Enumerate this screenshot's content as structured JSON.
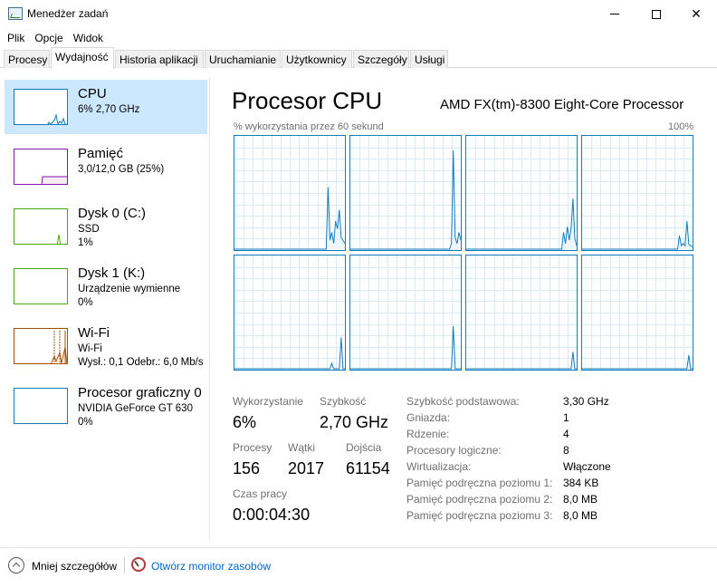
{
  "window": {
    "title": "Menedżer zadań"
  },
  "menu": [
    "Plik",
    "Opcje",
    "Widok"
  ],
  "tabs": [
    {
      "label": "Procesy",
      "active": false
    },
    {
      "label": "Wydajność",
      "active": true
    },
    {
      "label": "Historia aplikacji",
      "active": false
    },
    {
      "label": "Uruchamianie",
      "active": false
    },
    {
      "label": "Użytkownicy",
      "active": false
    },
    {
      "label": "Szczegóły",
      "active": false
    },
    {
      "label": "Usługi",
      "active": false
    }
  ],
  "resources": [
    {
      "title": "CPU",
      "line1": "6% 2,70 GHz",
      "line2": "",
      "color": "#117dbb",
      "selected": true
    },
    {
      "title": "Pamięć",
      "line1": "3,0/12,0 GB (25%)",
      "line2": "",
      "color": "#8b12ae",
      "selected": false
    },
    {
      "title": "Dysk 0 (C:)",
      "line1": "SSD",
      "line2": "1%",
      "color": "#4da60c",
      "selected": false
    },
    {
      "title": "Dysk 1 (K:)",
      "line1": "Urządzenie wymienne",
      "line2": "0%",
      "color": "#4da60c",
      "selected": false
    },
    {
      "title": "Wi-Fi",
      "line1": "Wi-Fi",
      "line2": "Wysł.: 0,1 Odebr.: 6,0 Mb/s",
      "color": "#a74f01",
      "selected": false
    },
    {
      "title": "Procesor graficzny 0",
      "line1": "NVIDIA GeForce GT 630",
      "line2": "0%",
      "color": "#117dbb",
      "selected": false
    }
  ],
  "main": {
    "title": "Procesor CPU",
    "processor_name": "AMD FX(tm)-8300 Eight-Core Processor",
    "graph_caption": "% wykorzystania przez 60 sekund",
    "graph_max": "100%",
    "graph_color": "#117dbb"
  },
  "stats": {
    "utilization_label": "Wykorzystanie",
    "utilization_value": "6%",
    "speed_label": "Szybkość",
    "speed_value": "2,70 GHz",
    "processes_label": "Procesy",
    "processes_value": "156",
    "threads_label": "Wątki",
    "threads_value": "2017",
    "handles_label": "Dojścia",
    "handles_value": "61154",
    "uptime_label": "Czas pracy",
    "uptime_value": "0:00:04:30"
  },
  "specs": [
    {
      "label": "Szybkość podstawowa:",
      "value": "3,30 GHz"
    },
    {
      "label": "Gniazda:",
      "value": "1"
    },
    {
      "label": "Rdzenie:",
      "value": "4"
    },
    {
      "label": "Procesory logiczne:",
      "value": "8"
    },
    {
      "label": "Wirtualizacja:",
      "value": "Włączone"
    },
    {
      "label": "Pamięć podręczna poziomu 1:",
      "value": "384 KB"
    },
    {
      "label": "Pamięć podręczna poziomu 2:",
      "value": "8,0 MB"
    },
    {
      "label": "Pamięć podręczna poziomu 3:",
      "value": "8,0 MB"
    }
  ],
  "footer": {
    "less_details": "Mniej szczegółów",
    "open_monitor": "Otwórz monitor zasobów"
  },
  "chart_data": {
    "type": "line",
    "ylim": [
      0,
      100
    ],
    "series": [
      {
        "values": [
          0,
          0,
          0,
          0,
          0,
          0,
          0,
          0,
          0,
          0,
          0,
          0,
          0,
          0,
          0,
          0,
          0,
          0,
          0,
          0,
          0,
          0,
          0,
          0,
          0,
          0,
          0,
          0,
          0,
          0,
          0,
          0,
          0,
          0,
          0,
          0,
          0,
          0,
          0,
          0,
          0,
          0,
          0,
          0,
          0,
          0,
          0,
          0,
          0,
          0,
          55,
          8,
          15,
          5,
          25,
          18,
          35,
          10,
          8,
          5
        ]
      },
      {
        "values": [
          0,
          0,
          0,
          0,
          0,
          0,
          0,
          0,
          0,
          0,
          0,
          0,
          0,
          0,
          0,
          0,
          0,
          0,
          0,
          0,
          0,
          0,
          0,
          0,
          0,
          0,
          0,
          0,
          0,
          0,
          0,
          0,
          0,
          0,
          0,
          0,
          0,
          0,
          0,
          0,
          0,
          0,
          0,
          0,
          0,
          0,
          0,
          0,
          0,
          0,
          0,
          0,
          0,
          0,
          5,
          88,
          10,
          5,
          15,
          8
        ]
      },
      {
        "values": [
          0,
          0,
          0,
          0,
          0,
          0,
          0,
          0,
          0,
          0,
          0,
          0,
          0,
          0,
          0,
          0,
          0,
          0,
          0,
          0,
          0,
          0,
          0,
          0,
          0,
          0,
          0,
          0,
          0,
          0,
          0,
          0,
          0,
          0,
          0,
          0,
          0,
          0,
          0,
          0,
          0,
          0,
          0,
          0,
          0,
          0,
          0,
          0,
          0,
          0,
          0,
          0,
          15,
          5,
          20,
          8,
          18,
          45,
          10,
          3
        ]
      },
      {
        "values": [
          0,
          0,
          0,
          0,
          0,
          0,
          0,
          0,
          0,
          0,
          0,
          0,
          0,
          0,
          0,
          0,
          0,
          0,
          0,
          0,
          0,
          0,
          0,
          0,
          0,
          0,
          0,
          0,
          0,
          0,
          0,
          0,
          0,
          0,
          0,
          0,
          0,
          0,
          0,
          0,
          0,
          0,
          0,
          0,
          0,
          0,
          0,
          0,
          0,
          0,
          0,
          0,
          12,
          3,
          5,
          3,
          25,
          4,
          3,
          2
        ]
      },
      {
        "values": [
          0,
          0,
          0,
          0,
          0,
          0,
          0,
          0,
          0,
          0,
          0,
          0,
          0,
          0,
          0,
          0,
          0,
          0,
          0,
          0,
          0,
          0,
          0,
          0,
          0,
          0,
          0,
          0,
          0,
          0,
          0,
          0,
          0,
          0,
          0,
          0,
          0,
          0,
          0,
          0,
          0,
          0,
          0,
          0,
          0,
          0,
          0,
          0,
          0,
          0,
          0,
          0,
          5,
          0,
          0,
          0,
          0,
          28,
          0,
          0
        ]
      },
      {
        "values": [
          0,
          0,
          0,
          0,
          0,
          0,
          0,
          0,
          0,
          0,
          0,
          0,
          0,
          0,
          0,
          0,
          0,
          0,
          0,
          0,
          0,
          0,
          0,
          0,
          0,
          0,
          0,
          0,
          0,
          0,
          0,
          0,
          0,
          0,
          0,
          0,
          0,
          0,
          0,
          0,
          0,
          0,
          0,
          0,
          0,
          0,
          0,
          0,
          0,
          0,
          0,
          0,
          0,
          0,
          0,
          38,
          0,
          0,
          0,
          0
        ]
      },
      {
        "values": [
          0,
          0,
          0,
          0,
          0,
          0,
          0,
          0,
          0,
          0,
          0,
          0,
          0,
          0,
          0,
          0,
          0,
          0,
          0,
          0,
          0,
          0,
          0,
          0,
          0,
          0,
          0,
          0,
          0,
          0,
          0,
          0,
          0,
          0,
          0,
          0,
          0,
          0,
          0,
          0,
          0,
          0,
          0,
          0,
          0,
          0,
          0,
          0,
          0,
          0,
          0,
          0,
          0,
          0,
          0,
          0,
          0,
          15,
          0,
          0
        ]
      },
      {
        "values": [
          0,
          0,
          0,
          0,
          0,
          0,
          0,
          0,
          0,
          0,
          0,
          0,
          0,
          0,
          0,
          0,
          0,
          0,
          0,
          0,
          0,
          0,
          0,
          0,
          0,
          0,
          0,
          0,
          0,
          0,
          0,
          0,
          0,
          0,
          0,
          0,
          0,
          0,
          0,
          0,
          0,
          0,
          0,
          0,
          0,
          0,
          0,
          0,
          0,
          0,
          0,
          0,
          0,
          0,
          0,
          0,
          0,
          12,
          0,
          0
        ]
      }
    ]
  }
}
